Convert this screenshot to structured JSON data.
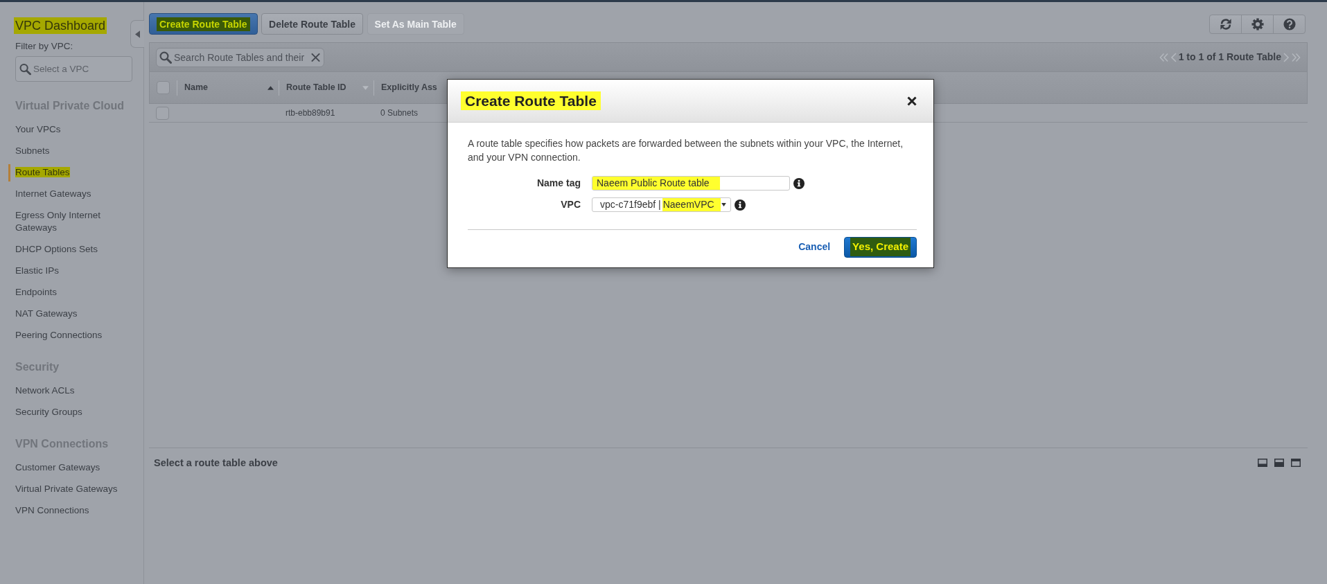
{
  "sidebar": {
    "title": {
      "text": "VPC Dashboard",
      "highlighted": true
    },
    "filter_label": "Filter by VPC:",
    "filter_field": {
      "placeholder": "Select a VPC"
    },
    "sections": [
      {
        "heading": "Virtual Private Cloud",
        "items": [
          {
            "label": "Your VPCs",
            "selected": false,
            "highlighted": false
          },
          {
            "label": "Subnets",
            "selected": false,
            "highlighted": false
          },
          {
            "label": "Route Tables",
            "selected": true,
            "highlighted": true
          },
          {
            "label": "Internet Gateways",
            "selected": false,
            "highlighted": false
          },
          {
            "label": "Egress Only Internet Gateways",
            "selected": false,
            "highlighted": false
          },
          {
            "label": "DHCP Options Sets",
            "selected": false,
            "highlighted": false
          },
          {
            "label": "Elastic IPs",
            "selected": false,
            "highlighted": false
          },
          {
            "label": "Endpoints",
            "selected": false,
            "highlighted": false
          },
          {
            "label": "NAT Gateways",
            "selected": false,
            "highlighted": false
          },
          {
            "label": "Peering Connections",
            "selected": false,
            "highlighted": false
          }
        ]
      },
      {
        "heading": "Security",
        "items": [
          {
            "label": "Network ACLs",
            "selected": false,
            "highlighted": false
          },
          {
            "label": "Security Groups",
            "selected": false,
            "highlighted": false
          }
        ]
      },
      {
        "heading": "VPN Connections",
        "items": [
          {
            "label": "Customer Gateways",
            "selected": false,
            "highlighted": false
          },
          {
            "label": "Virtual Private Gateways",
            "selected": false,
            "highlighted": false
          },
          {
            "label": "VPN Connections",
            "selected": false,
            "highlighted": false
          }
        ]
      }
    ]
  },
  "toolbar": {
    "buttons": [
      {
        "label": "Create Route Table",
        "kind": "primary",
        "disabled": false,
        "highlighted": true
      },
      {
        "label": "Delete Route Table",
        "kind": "default",
        "disabled": false,
        "highlighted": false
      },
      {
        "label": "Set As Main Table",
        "kind": "default",
        "disabled": true,
        "highlighted": false
      }
    ]
  },
  "filter_bar": {
    "search": {
      "placeholder": "Search Route Tables and their"
    },
    "pagination": "1 to 1 of 1 Route Table"
  },
  "table": {
    "select_all_checked": false,
    "columns": [
      {
        "label": "Name",
        "sorted": true
      },
      {
        "label": "Route Table ID",
        "sorted": false
      },
      {
        "label": "Explicitly Ass"
      }
    ],
    "rows": [
      {
        "checked": false,
        "route_table_id": "rtb-ebb89b91",
        "column_3": "0 Subnets"
      }
    ]
  },
  "details_panel": {
    "message": "Select a route table above"
  },
  "modal": {
    "title": {
      "text": "Create Route Table",
      "highlighted": true
    },
    "description": "A route table specifies how packets are forwarded between the subnets within your VPC, the Internet, and your VPN connection.",
    "fields": [
      {
        "kind": "text",
        "label": "Name tag",
        "value_parts": [
          {
            "text": "Naeem Public Route table",
            "highlighted": true
          }
        ]
      },
      {
        "kind": "select",
        "label": "VPC",
        "value_parts": [
          {
            "text": "vpc-c71f9ebf |",
            "highlighted": false
          },
          {
            "text": "NaeemVPC",
            "highlighted": true
          }
        ]
      }
    ],
    "buttons": [
      {
        "label": "Cancel",
        "kind": "link",
        "highlighted": false
      },
      {
        "label": "Yes, Create",
        "kind": "primary",
        "highlighted": true
      }
    ]
  }
}
